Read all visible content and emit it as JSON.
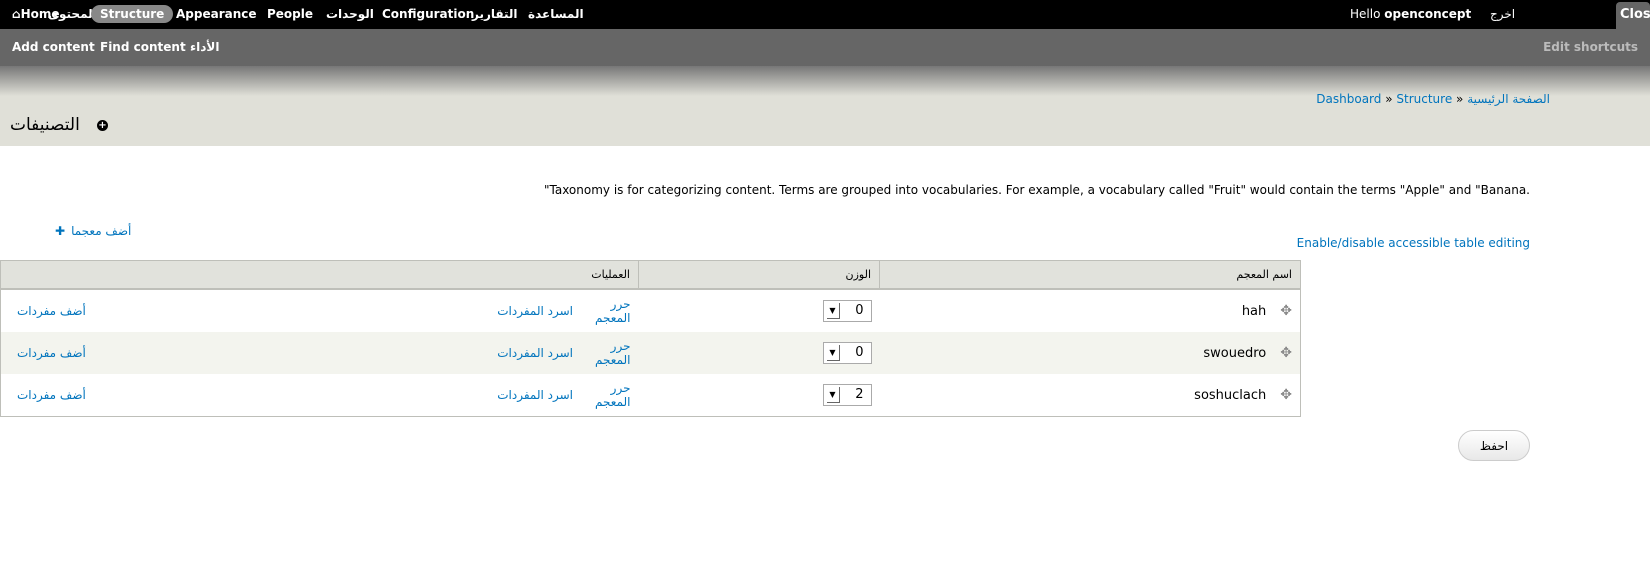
{
  "toolbar": {
    "home": "Home",
    "items": [
      "المحتوى",
      "Structure",
      "Appearance",
      "People",
      "الوحدات",
      "Configuration",
      "التقارير",
      "المساعدة"
    ],
    "hello": "Hello ",
    "user": "openconcept",
    "logout": "اخرج",
    "close": "Close"
  },
  "shortcuts": {
    "items": [
      "Add content",
      "Find content",
      "الأداء"
    ],
    "edit": "Edit shortcuts"
  },
  "breadcrumb": [
    "الصفحة الرئيسية",
    "Dashboard",
    "Structure"
  ],
  "page_title": "التصنيفات",
  "description": "\"Taxonomy is for categorizing content. Terms are grouped into vocabularies. For example, a vocabulary called \"Fruit\" would contain the terms \"Apple\" and \"Banana.",
  "add_vocabulary": "أضف معجما",
  "toggle_weights": "Enable/disable accessible table editing",
  "table": {
    "headers": [
      "اسم المعجم",
      "الوزن",
      "العمليات"
    ],
    "rows": [
      {
        "name": "hah",
        "weight": "0",
        "edit": "حرر المعجم",
        "list": "اسرد المفردات",
        "add": "أضف مفردات"
      },
      {
        "name": "swouedro",
        "weight": "0",
        "edit": "حرر المعجم",
        "list": "اسرد المفردات",
        "add": "أضف مفردات"
      },
      {
        "name": "soshuclach",
        "weight": "2",
        "edit": "حرر المعجم",
        "list": "اسرد المفردات",
        "add": "أضف مفردات"
      }
    ]
  },
  "save": "احفظ"
}
